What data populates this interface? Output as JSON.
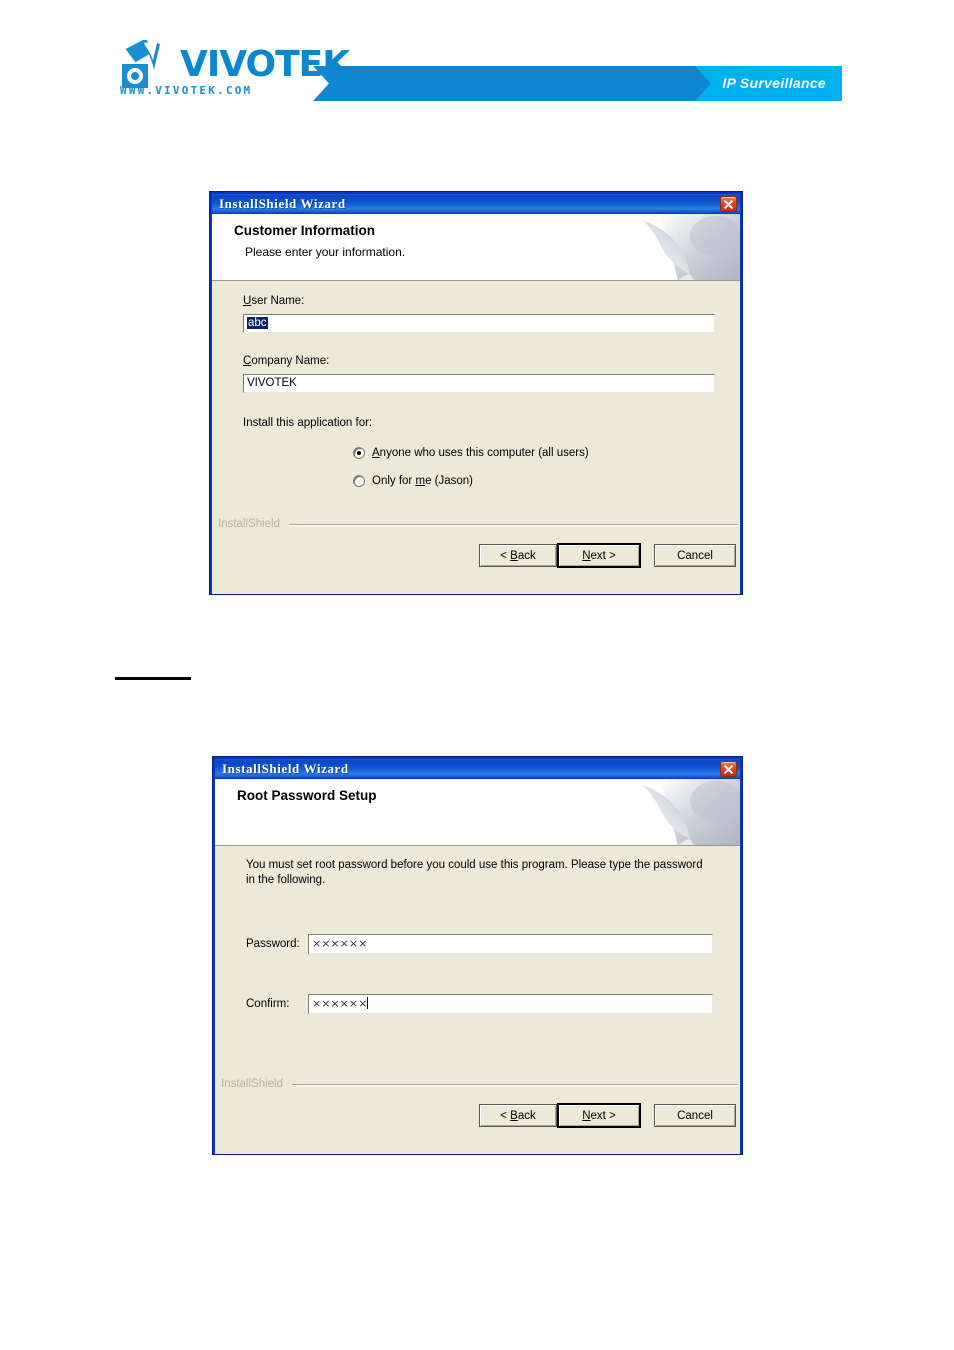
{
  "header": {
    "logo_wordmark": "VIVOTEK",
    "logo_url": "WWW.VIVOTEK.COM",
    "banner_label": "IP Surveillance",
    "colors": {
      "brand_blue": "#0b87cf",
      "banner_dark": "#0e86d1",
      "banner_light": "#00b1ef"
    }
  },
  "dialog1": {
    "titlebar": "InstallShield Wizard",
    "close_label": "Close",
    "banner_title": "Customer Information",
    "banner_subtitle": "Please enter your information.",
    "user_name_label": "User Name:",
    "user_name_value": "abc",
    "user_name_selected": true,
    "company_name_label": "Company Name:",
    "company_name_value": "VIVOTEK",
    "install_for_label": "Install this application for:",
    "radio_options": [
      {
        "label": "Anyone who uses this computer (all users)",
        "checked": true
      },
      {
        "label": "Only for me (Jason)",
        "checked": false
      }
    ],
    "installshield_mark": "InstallShield",
    "buttons": {
      "back": "< Back",
      "next": "Next >",
      "cancel": "Cancel",
      "default": "next"
    }
  },
  "dialog2": {
    "titlebar": "InstallShield Wizard",
    "close_label": "Close",
    "banner_title": "Root Password Setup",
    "banner_subtitle": "",
    "instruction": "You must set root password before you could use this program. Please type the password in the following.",
    "password_label": "Password:",
    "password_value": "××××××",
    "password_char_count": 6,
    "confirm_label": "Confirm:",
    "confirm_value": "××××××",
    "confirm_char_count": 6,
    "confirm_has_caret": true,
    "installshield_mark": "InstallShield",
    "buttons": {
      "back": "< Back",
      "next": "Next >",
      "cancel": "Cancel",
      "default": "next"
    }
  }
}
